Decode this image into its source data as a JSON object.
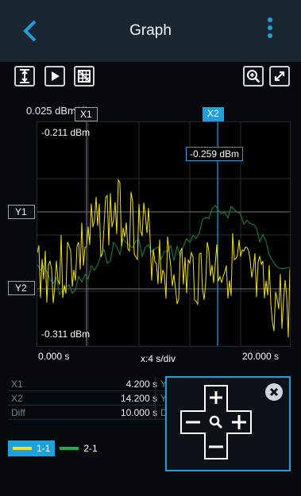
{
  "header": {
    "title": "Graph"
  },
  "graph": {
    "scale_y": "0.025 dBm/div",
    "top_value": "-0.211 dBm",
    "bottom_value": "-0.311 dBm",
    "x_start": "0.000 s",
    "x_end": "20.000 s",
    "x_scale": "x:4 s/div",
    "cursor_readout": "-0.259 dBm",
    "markers": {
      "x1": "X1",
      "x2": "X2",
      "y1": "Y1",
      "y2": "Y2"
    }
  },
  "table": {
    "rows": [
      {
        "label": "X1",
        "value": "4.200 s"
      },
      {
        "label": "X2",
        "value": "14.200 s"
      },
      {
        "label": "Diff",
        "value": "10.000 s"
      }
    ],
    "col2": [
      "Y",
      "Y",
      "D"
    ]
  },
  "legend": [
    {
      "label": "1-1",
      "color": "#f0e020",
      "selected": true
    },
    {
      "label": "2-1",
      "color": "#1faa50",
      "selected": false
    }
  ],
  "colors": {
    "accent": "#1ea0dc",
    "trace1": "#f0e020",
    "trace2": "#1d8a3c"
  },
  "icons": {
    "back": "chevron-left-icon",
    "menu": "kebab-menu-icon",
    "autoscale": "vertical-fit-icon",
    "run": "play-icon",
    "grid": "grid-icon",
    "zoom": "zoom-in-icon",
    "fullscreen": "expand-icon"
  }
}
